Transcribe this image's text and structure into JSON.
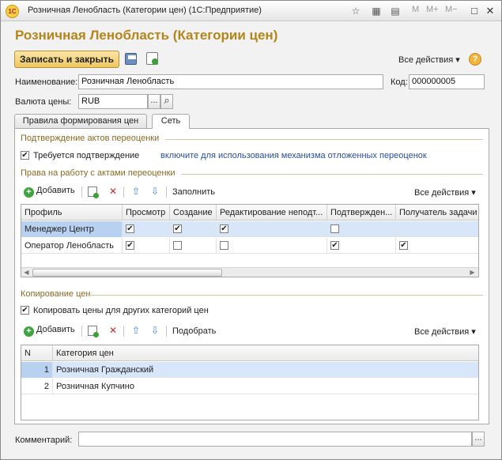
{
  "window": {
    "title": "Розничная Ленобласть (Категории цен)",
    "app": "(1С:Предприятие)",
    "logo_text": "1С",
    "memory": {
      "m": "M",
      "m_plus": "M+",
      "m_minus": "M−"
    }
  },
  "form": {
    "title": "Розничная Ленобласть (Категории цен)",
    "toolbar": {
      "save_close_label": "Записать и закрыть",
      "all_actions_label": "Все действия ▾"
    },
    "name_label": "Наименование:",
    "name_value": "Розничная Ленобласть",
    "code_label": "Код:",
    "code_value": "000000005",
    "currency_label": "Валюта цены:",
    "currency_value": "RUB",
    "tabs": [
      {
        "label": "Правила формирования цен",
        "active": false
      },
      {
        "label": "Сеть",
        "active": true
      }
    ],
    "comment_label": "Комментарий:",
    "comment_value": ""
  },
  "network_tab": {
    "confirm_group": {
      "header": "Подтверждение актов переоценки",
      "checkbox_label": "Требуется подтверждение",
      "checked": true,
      "hint_link": "включите для использования механизма отложенных переоценок"
    },
    "rights_group": {
      "header": "Права на работу с актами переоценки",
      "add_label": "Добавить",
      "fill_label": "Заполнить",
      "all_actions_label": "Все действия ▾",
      "columns": [
        "Профиль",
        "Просмотр",
        "Создание",
        "Редактирование неподт...",
        "Подтвержден...",
        "Получатель задачи"
      ],
      "rows": [
        {
          "profile": "Менеджер Центр",
          "flags": [
            true,
            true,
            true,
            false,
            false
          ],
          "selected": true
        },
        {
          "profile": "Оператор Ленобласть",
          "flags": [
            true,
            false,
            false,
            true,
            true
          ],
          "selected": false
        }
      ]
    },
    "copy_group": {
      "header": "Копирование цен",
      "checkbox_label": "Копировать цены для других категорий цен",
      "checked": true,
      "add_label": "Добавить",
      "pick_label": "Подобрать",
      "all_actions_label": "Все действия ▾",
      "columns": [
        "N",
        "Категория цен"
      ],
      "rows": [
        {
          "n": "1",
          "category": "Розничная Гражданский",
          "selected": true
        },
        {
          "n": "2",
          "category": "Розничная Купчино",
          "selected": false
        }
      ]
    }
  },
  "icons": {
    "save": "save-disk-icon",
    "post": "document-check-icon",
    "help": "?",
    "ellipsis": "...",
    "search": "⌕",
    "add": "+",
    "delete": "✕",
    "up": "⇧",
    "down": "⇩",
    "check": "✔"
  }
}
